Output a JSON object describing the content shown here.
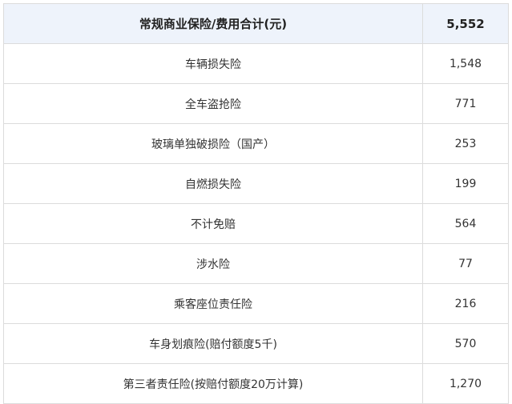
{
  "header": {
    "label": "常规商业保险/费用合计(元)",
    "value": "5,552"
  },
  "rows": [
    {
      "label": "车辆损失险",
      "value": "1,548"
    },
    {
      "label": "全车盗抢险",
      "value": "771"
    },
    {
      "label": "玻璃单独破损险（国产）",
      "value": "253"
    },
    {
      "label": "自燃损失险",
      "value": "199"
    },
    {
      "label": "不计免赔",
      "value": "564"
    },
    {
      "label": "涉水险",
      "value": "77"
    },
    {
      "label": "乘客座位责任险",
      "value": "216"
    },
    {
      "label": "车身划痕险(赔付额度5千)",
      "value": "570"
    },
    {
      "label": "第三者责任险(按赔付额度20万计算)",
      "value": "1,270"
    }
  ]
}
